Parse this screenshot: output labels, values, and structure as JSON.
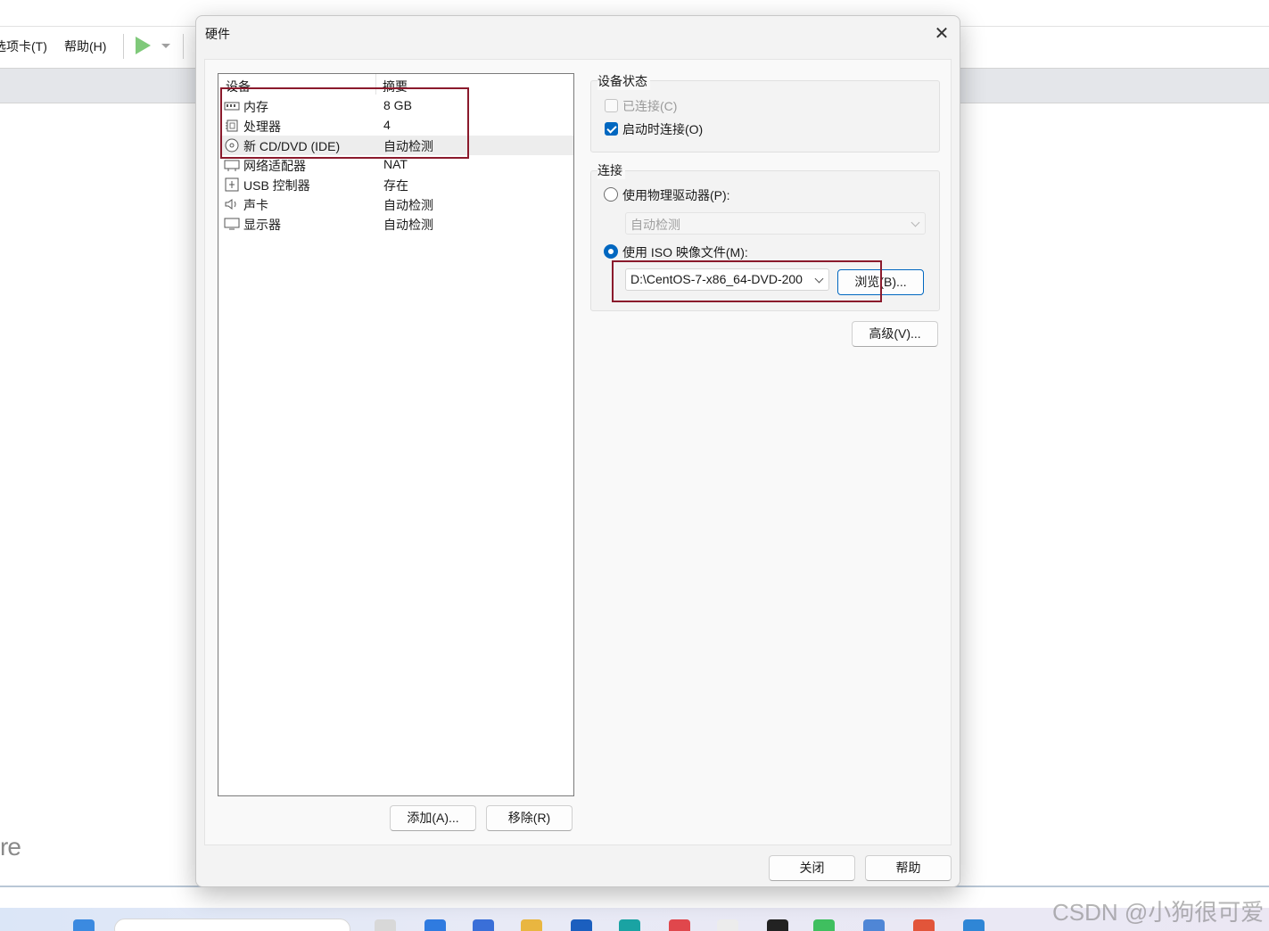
{
  "background_app": {
    "menu": [
      "选项卡(T)",
      "帮助(H)"
    ],
    "brand_fragment": "re",
    "watermark": "CSDN @小狗很可爱"
  },
  "dialog": {
    "title": "硬件",
    "close_glyph": "✕",
    "device_table": {
      "headers": [
        "设备",
        "摘要"
      ],
      "rows": [
        {
          "name": "内存",
          "summary": "8 GB",
          "icon": "memory-icon"
        },
        {
          "name": "处理器",
          "summary": "4",
          "icon": "cpu-icon"
        },
        {
          "name": "新 CD/DVD (IDE)",
          "summary": "自动检测",
          "icon": "cd-dvd-icon",
          "selected": true
        },
        {
          "name": "网络适配器",
          "summary": "NAT",
          "icon": "network-icon"
        },
        {
          "name": "USB 控制器",
          "summary": "存在",
          "icon": "usb-icon"
        },
        {
          "name": "声卡",
          "summary": "自动检测",
          "icon": "speaker-icon"
        },
        {
          "name": "显示器",
          "summary": "自动检测",
          "icon": "monitor-icon"
        }
      ]
    },
    "add_button": "添加(A)...",
    "remove_button": "移除(R)",
    "device_status": {
      "title": "设备状态",
      "connected": {
        "label": "已连接(C)",
        "checked": false,
        "disabled": true
      },
      "connect_on_start": {
        "label": "启动时连接(O)",
        "checked": true
      }
    },
    "connection": {
      "title": "连接",
      "physical_drive": {
        "label": "使用物理驱动器(P):",
        "selected": false,
        "value": "自动检测"
      },
      "iso_image": {
        "label": "使用 ISO 映像文件(M):",
        "selected": true,
        "value": "D:\\CentOS-7-x86_64-DVD-200"
      },
      "browse_button": "浏览(B)..."
    },
    "advanced_button": "高级(V)...",
    "close_button": "关闭",
    "help_button": "帮助"
  },
  "colors": {
    "accent": "#0067c0",
    "highlight_box": "#8b1a2c"
  }
}
